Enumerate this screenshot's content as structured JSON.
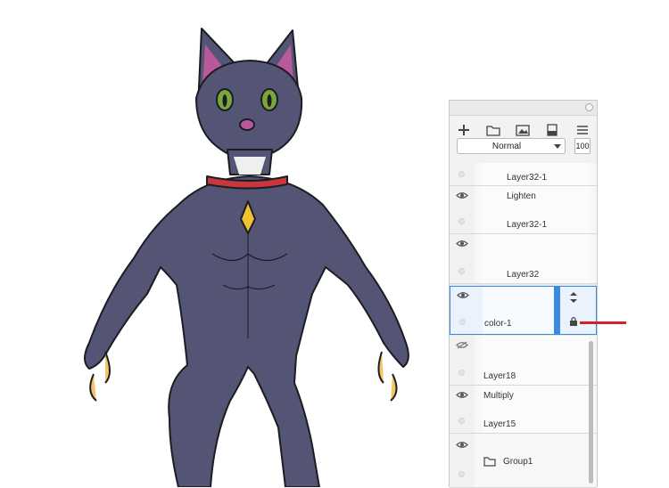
{
  "panel": {
    "toolbar": {
      "icons": [
        "plus-icon",
        "folder-icon",
        "image-icon",
        "clipboard-icon",
        "menu-icon"
      ]
    },
    "blend_mode": "Normal",
    "opacity": "100"
  },
  "layers": [
    {
      "name": "Layer32-1",
      "mode": "",
      "visible": false,
      "selected": false
    },
    {
      "name": "Layer32-1",
      "mode": "Lighten",
      "visible": true,
      "selected": false
    },
    {
      "name": "Layer32",
      "mode": "",
      "visible": true,
      "selected": false
    },
    {
      "name": "color-1",
      "mode": "",
      "visible": true,
      "selected": true
    },
    {
      "name": "Layer18",
      "mode": "",
      "visible": false,
      "selected": false
    },
    {
      "name": "Layer15",
      "mode": "Multiply",
      "visible": true,
      "selected": false
    },
    {
      "name": "Group1",
      "mode": "",
      "visible": true,
      "selected": false
    }
  ],
  "colors": {
    "fur": "#545574",
    "collar": "#c8373e",
    "tag": "#f2c12e",
    "eyes": "#7aa63a",
    "ears": "#b85a9a",
    "claws": "#f5c46a",
    "highlight": "#d62026"
  }
}
